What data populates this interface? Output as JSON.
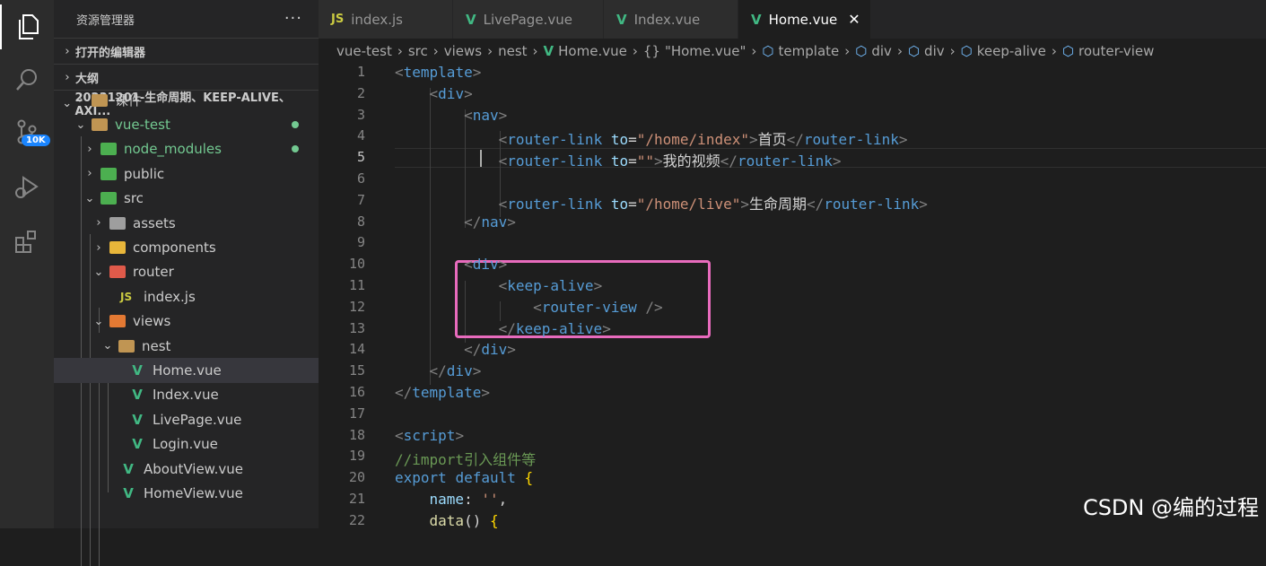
{
  "activity_bar": {
    "items": [
      {
        "name": "explorer-icon"
      },
      {
        "name": "search-icon"
      },
      {
        "name": "source-control-icon",
        "badge": "10K"
      },
      {
        "name": "run-debug-icon"
      },
      {
        "name": "extensions-icon"
      }
    ]
  },
  "sidebar": {
    "title": "资源管理器",
    "more": "···",
    "sections": {
      "open_editors": "打开的编辑器",
      "outline": "大纲",
      "workspace": "20231201-生命周期、KEEP-ALIVE、AXI..."
    },
    "tree": [
      {
        "label": "课件"
      },
      {
        "label": "vue-test"
      },
      {
        "label": "node_modules"
      },
      {
        "label": "public"
      },
      {
        "label": "src"
      },
      {
        "label": "assets"
      },
      {
        "label": "components"
      },
      {
        "label": "router"
      },
      {
        "label": "index.js"
      },
      {
        "label": "views"
      },
      {
        "label": "nest"
      },
      {
        "label": "Home.vue"
      },
      {
        "label": "Index.vue"
      },
      {
        "label": "LivePage.vue"
      },
      {
        "label": "Login.vue"
      },
      {
        "label": "AboutView.vue"
      },
      {
        "label": "HomeView.vue"
      }
    ]
  },
  "tabs": [
    {
      "icon": "JS",
      "label": "index.js"
    },
    {
      "icon": "V",
      "label": "LivePage.vue"
    },
    {
      "icon": "V",
      "label": "Index.vue"
    },
    {
      "icon": "V",
      "label": "Home.vue",
      "close": "✕"
    }
  ],
  "breadcrumb": [
    "vue-test",
    "src",
    "views",
    "nest",
    "Home.vue",
    "\"Home.vue\"",
    "template",
    "div",
    "div",
    "keep-alive",
    "router-view"
  ],
  "breadcrumb_icons": {
    "vue": "V",
    "braces": "{}"
  },
  "editor": {
    "line_numbers": [
      "1",
      "2",
      "3",
      "4",
      "5",
      "6",
      "7",
      "8",
      "9",
      "10",
      "11",
      "12",
      "13",
      "14",
      "15",
      "16",
      "17",
      "18",
      "19",
      "20",
      "21",
      "22"
    ],
    "lines": [
      {
        "indent": "",
        "parts": [
          [
            "<",
            "b"
          ],
          [
            "template",
            "tag"
          ],
          [
            ">",
            "b"
          ]
        ]
      },
      {
        "indent": "    ",
        "parts": [
          [
            "<",
            "b"
          ],
          [
            "div",
            "tag"
          ],
          [
            ">",
            "b"
          ]
        ]
      },
      {
        "indent": "        ",
        "parts": [
          [
            "<",
            "b"
          ],
          [
            "nav",
            "tag"
          ],
          [
            ">",
            "b"
          ]
        ]
      },
      {
        "indent": "            ",
        "parts": [
          [
            "<",
            "b"
          ],
          [
            "router-link",
            "tag"
          ],
          [
            " ",
            "txt"
          ],
          [
            "to",
            "attr"
          ],
          [
            "=",
            "txt"
          ],
          [
            "\"/home/index\"",
            "str"
          ],
          [
            ">",
            "b"
          ],
          [
            "首页",
            "txt"
          ],
          [
            "</",
            "b"
          ],
          [
            "router-link",
            "tag"
          ],
          [
            ">",
            "b"
          ]
        ]
      },
      {
        "indent": "            ",
        "parts": [
          [
            "<",
            "b"
          ],
          [
            "router-link",
            "tag"
          ],
          [
            " ",
            "txt"
          ],
          [
            "to",
            "attr"
          ],
          [
            "=",
            "txt"
          ],
          [
            "\"\"",
            "str"
          ],
          [
            ">",
            "b"
          ],
          [
            "我的视频",
            "txt"
          ],
          [
            "</",
            "b"
          ],
          [
            "router-link",
            "tag"
          ],
          [
            ">",
            "b"
          ]
        ]
      },
      {
        "indent": "",
        "parts": []
      },
      {
        "indent": "            ",
        "parts": [
          [
            "<",
            "b"
          ],
          [
            "router-link",
            "tag"
          ],
          [
            " ",
            "txt"
          ],
          [
            "to",
            "attr"
          ],
          [
            "=",
            "txt"
          ],
          [
            "\"/home/live\"",
            "str"
          ],
          [
            ">",
            "b"
          ],
          [
            "生命周期",
            "txt"
          ],
          [
            "</",
            "b"
          ],
          [
            "router-link",
            "tag"
          ],
          [
            ">",
            "b"
          ]
        ]
      },
      {
        "indent": "        ",
        "parts": [
          [
            "</",
            "b"
          ],
          [
            "nav",
            "tag"
          ],
          [
            ">",
            "b"
          ]
        ]
      },
      {
        "indent": "",
        "parts": []
      },
      {
        "indent": "        ",
        "parts": [
          [
            "<",
            "b"
          ],
          [
            "div",
            "tag"
          ],
          [
            ">",
            "b"
          ]
        ]
      },
      {
        "indent": "            ",
        "parts": [
          [
            "<",
            "b"
          ],
          [
            "keep-alive",
            "tag"
          ],
          [
            ">",
            "b"
          ]
        ]
      },
      {
        "indent": "                ",
        "parts": [
          [
            "<",
            "b"
          ],
          [
            "router-view",
            "tag"
          ],
          [
            " />",
            "b"
          ]
        ]
      },
      {
        "indent": "            ",
        "parts": [
          [
            "</",
            "b"
          ],
          [
            "keep-alive",
            "tag"
          ],
          [
            ">",
            "b"
          ]
        ]
      },
      {
        "indent": "        ",
        "parts": [
          [
            "</",
            "b"
          ],
          [
            "div",
            "tag"
          ],
          [
            ">",
            "b"
          ]
        ]
      },
      {
        "indent": "    ",
        "parts": [
          [
            "</",
            "b"
          ],
          [
            "div",
            "tag"
          ],
          [
            ">",
            "b"
          ]
        ]
      },
      {
        "indent": "",
        "parts": [
          [
            "</",
            "b"
          ],
          [
            "template",
            "tag"
          ],
          [
            ">",
            "b"
          ]
        ]
      },
      {
        "indent": "",
        "parts": []
      },
      {
        "indent": "",
        "parts": [
          [
            "<",
            "b"
          ],
          [
            "script",
            "tag"
          ],
          [
            ">",
            "b"
          ]
        ]
      },
      {
        "indent": "",
        "parts": [
          [
            "//import引入组件等",
            "com"
          ]
        ]
      },
      {
        "indent": "",
        "parts": [
          [
            "export",
            "kw2"
          ],
          [
            " ",
            "txt"
          ],
          [
            "default",
            "kw2"
          ],
          [
            " ",
            "txt"
          ],
          [
            "{",
            "br"
          ]
        ]
      },
      {
        "indent": "    ",
        "parts": [
          [
            "name",
            "prop"
          ],
          [
            ": ",
            "txt"
          ],
          [
            "''",
            "str"
          ],
          [
            ",",
            "txt"
          ]
        ]
      },
      {
        "indent": "    ",
        "parts": [
          [
            "data",
            "fn"
          ],
          [
            "() ",
            "txt"
          ],
          [
            "{",
            "br"
          ]
        ]
      }
    ]
  },
  "watermark": "CSDN @编的过程"
}
